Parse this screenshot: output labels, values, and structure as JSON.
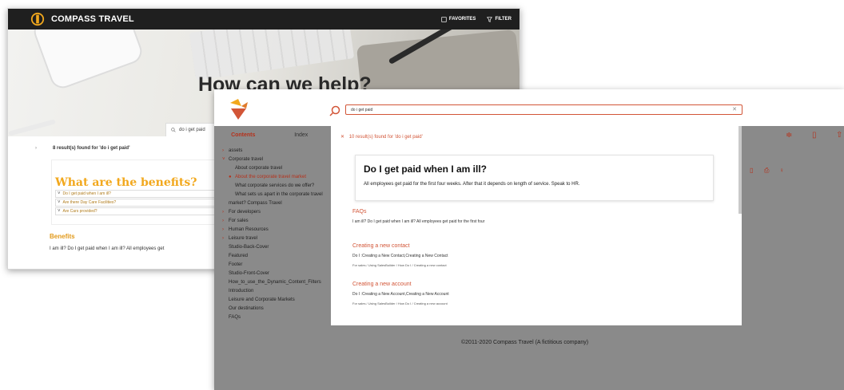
{
  "back": {
    "brand": "COMPASS TRAVEL",
    "favorites_label": "FAVORITES",
    "filter_label": "FILTER",
    "hero_title": "How can we help?",
    "search_value": "do i get paid",
    "results_count": "8 result(s) found for 'do i get paid'",
    "card_title": "What are the benefits?",
    "faq_rows": [
      "Do I get paid when I am ill?",
      "Are there Day Care Facilities?",
      "Are Cars provided?"
    ],
    "benefits_title": "Benefits",
    "benefits_text": "I am ill? Do I get paid when I am ill? All employees get"
  },
  "front": {
    "search_value": "do i get paid",
    "tabs": {
      "contents": "Contents",
      "index": "Index"
    },
    "sidebar": [
      {
        "label": "assets",
        "level": 0,
        "chevron": "›"
      },
      {
        "label": "Corporate travel",
        "level": 0,
        "chevron": "˅"
      },
      {
        "label": "About corporate travel",
        "level": 1,
        "chevron": ""
      },
      {
        "label": "About the corporate travel market",
        "level": 1,
        "chevron": "●",
        "active": true
      },
      {
        "label": "What corporate services do we offer?",
        "level": 1,
        "chevron": ""
      },
      {
        "label": "What sets us apart in the corporate travel market? Compass Travel",
        "level": 1,
        "chevron": ""
      },
      {
        "label": "For developers",
        "level": 0,
        "chevron": "›"
      },
      {
        "label": "For sales",
        "level": 0,
        "chevron": "›"
      },
      {
        "label": "Human Resources",
        "level": 0,
        "chevron": "›"
      },
      {
        "label": "Leisure travel",
        "level": 0,
        "chevron": "›"
      },
      {
        "label": "Studio-Back-Cover",
        "level": 0,
        "chevron": ""
      },
      {
        "label": "Featured",
        "level": 0,
        "chevron": ""
      },
      {
        "label": "Footer",
        "level": 0,
        "chevron": ""
      },
      {
        "label": "Studio-Front-Cover",
        "level": 0,
        "chevron": ""
      },
      {
        "label": "How_to_use_the_Dynamic_Content_Filters",
        "level": 0,
        "chevron": ""
      },
      {
        "label": "Introduction",
        "level": 0,
        "chevron": ""
      },
      {
        "label": "Leisure and Corporate Markets",
        "level": 0,
        "chevron": ""
      },
      {
        "label": "Our destinations",
        "level": 0,
        "chevron": ""
      },
      {
        "label": "FAQs",
        "level": 0,
        "chevron": ""
      }
    ],
    "results_count": "10 result(s) found for 'do i get paid'",
    "answer_title": "Do I get paid when I am ill?",
    "answer_text": "All employees get paid for the first four weeks. After that it depends on length of service. Speak to HR.",
    "results": [
      {
        "title": "FAQs",
        "text": "I am ill? Do I get paid when I am ill? All employees get paid for the first four",
        "path": ""
      },
      {
        "title": "Creating a new contact",
        "text": "Do I :Creating a New Contact,Creating a New Contact",
        "path": "For sales / Using SalesBuilder / How Do I / Creating a new contact"
      },
      {
        "title": "Creating a new account",
        "text": "Do I :Creating a New Account,Creating a New Account",
        "path": "For sales / Using SalesBuilder / How Do I / Creating a new account"
      }
    ],
    "copyright": "©2011-2020 Compass Travel (A fictitious company)"
  },
  "colors": {
    "accent": "#d25537",
    "gold": "#f2a81d",
    "topbar": "#1f1f1f"
  },
  "icons": [
    "compass-logo-icon",
    "favorites-icon",
    "filter-icon",
    "search-icon",
    "close-icon",
    "bookmark-icon",
    "share-icon",
    "print-icon",
    "lightbulb-icon",
    "sort-icon"
  ]
}
